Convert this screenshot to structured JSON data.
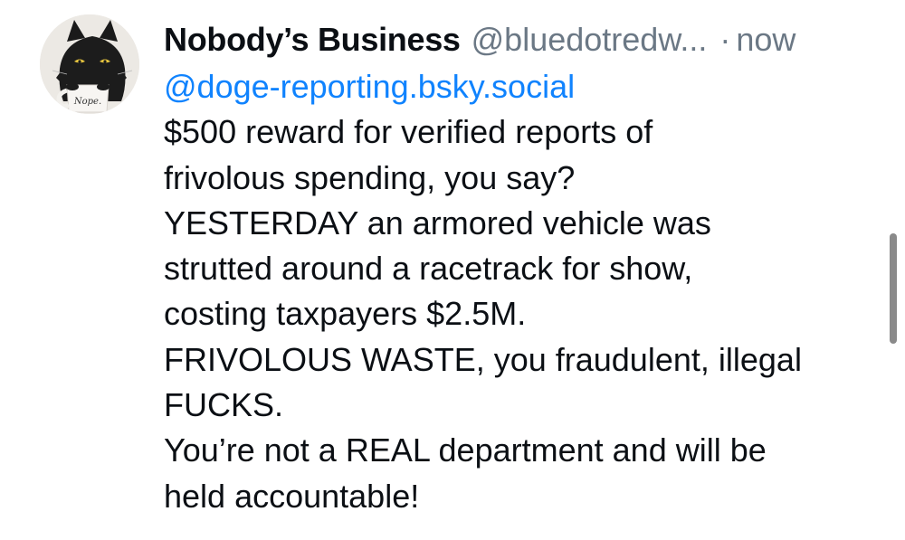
{
  "post": {
    "author": {
      "display_name": "Nobody’s Business",
      "handle": "@bluedotredw...",
      "avatar_icon": "cat-with-mug-avatar-icon",
      "avatar_mug_text": "Nope."
    },
    "separator": "·",
    "timestamp": "now",
    "mention": "@doge-reporting.bsky.social",
    "body_lines": [
      "$500 reward for verified reports of",
      "frivolous spending, you say?",
      "YESTERDAY an armored vehicle was",
      "strutted around a racetrack for show,",
      "costing taxpayers $2.5M.",
      "FRIVOLOUS WASTE, you fraudulent, illegal",
      "FUCKS.",
      "You’re not a REAL department and will be",
      "held accountable!"
    ]
  },
  "colors": {
    "text": "#0b0f14",
    "secondary": "#6b7885",
    "link": "#1083fe",
    "scrollbar": "#8a8a8a"
  }
}
